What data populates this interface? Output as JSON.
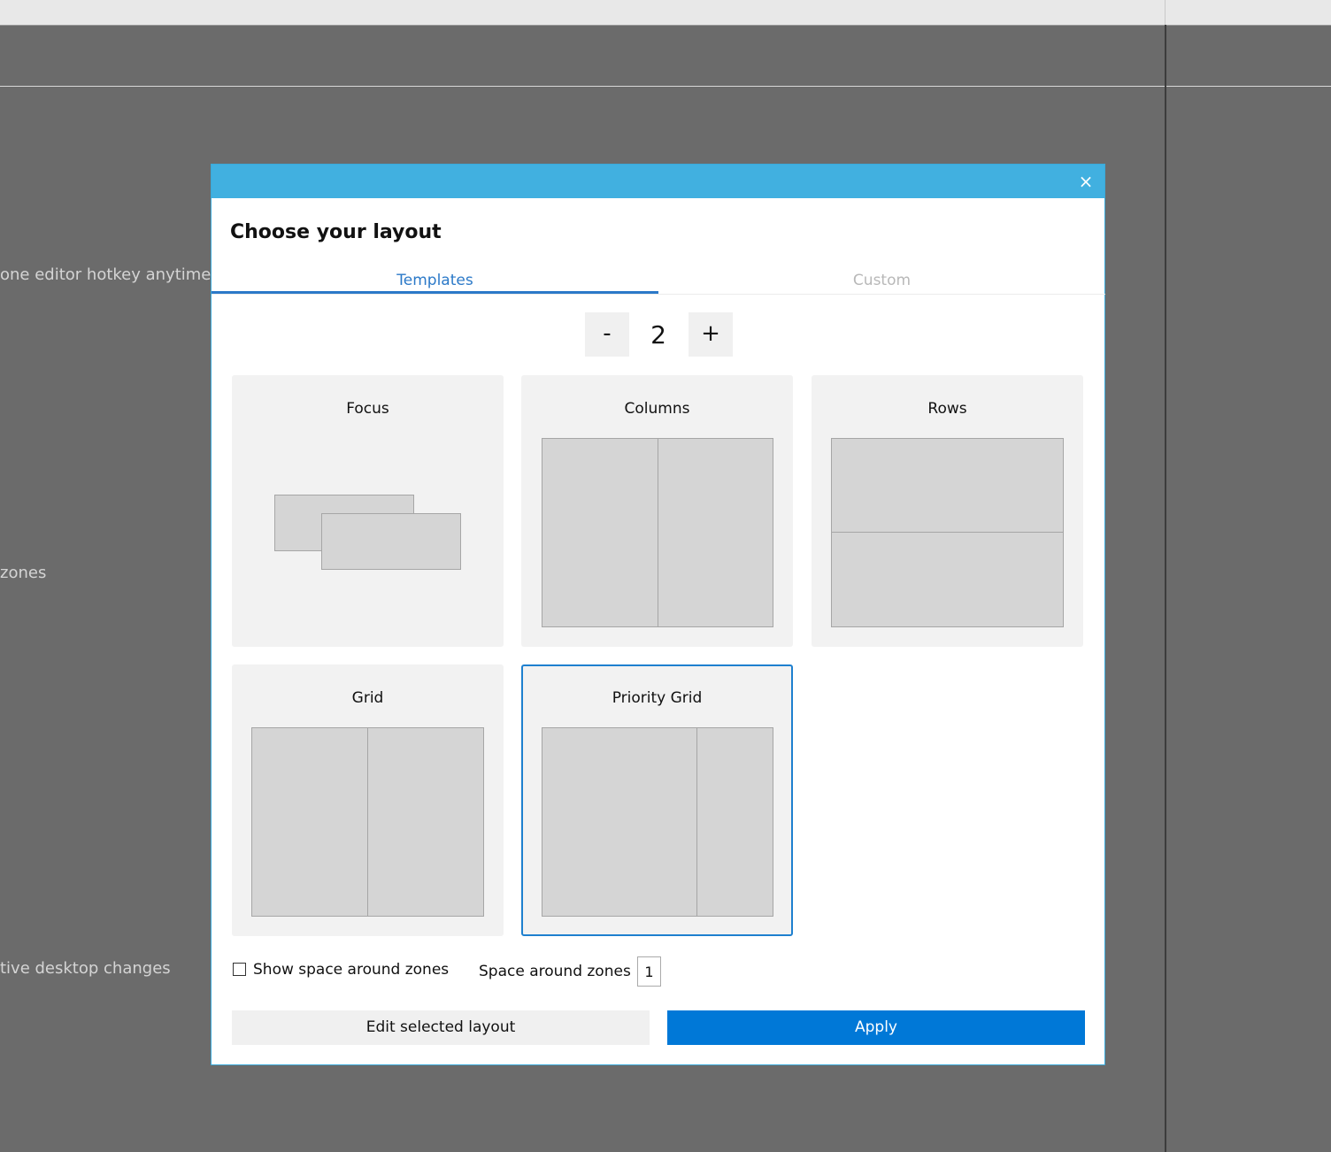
{
  "background": {
    "texts": [
      "one editor hotkey anytime",
      "zones",
      "tive desktop changes"
    ]
  },
  "dialog": {
    "close_icon": "×",
    "heading": "Choose your layout",
    "tabs": [
      {
        "label": "Templates",
        "active": true
      },
      {
        "label": "Custom",
        "active": false
      }
    ],
    "zone_count": {
      "minus_label": "-",
      "value": "2",
      "plus_label": "+"
    },
    "templates": [
      {
        "name": "Focus",
        "selected": false
      },
      {
        "name": "Columns",
        "selected": false
      },
      {
        "name": "Rows",
        "selected": false
      },
      {
        "name": "Grid",
        "selected": false
      },
      {
        "name": "Priority Grid",
        "selected": true
      }
    ],
    "show_space_label": "Show space around zones",
    "show_space_checked": false,
    "space_label": "Space around zones",
    "space_value": "1",
    "edit_button": "Edit selected layout",
    "apply_button": "Apply"
  },
  "colors": {
    "titlebar": "#41b0e0",
    "accent": "#2b79c8",
    "apply": "#0078d7",
    "backdrop": "#6b6b6b"
  }
}
